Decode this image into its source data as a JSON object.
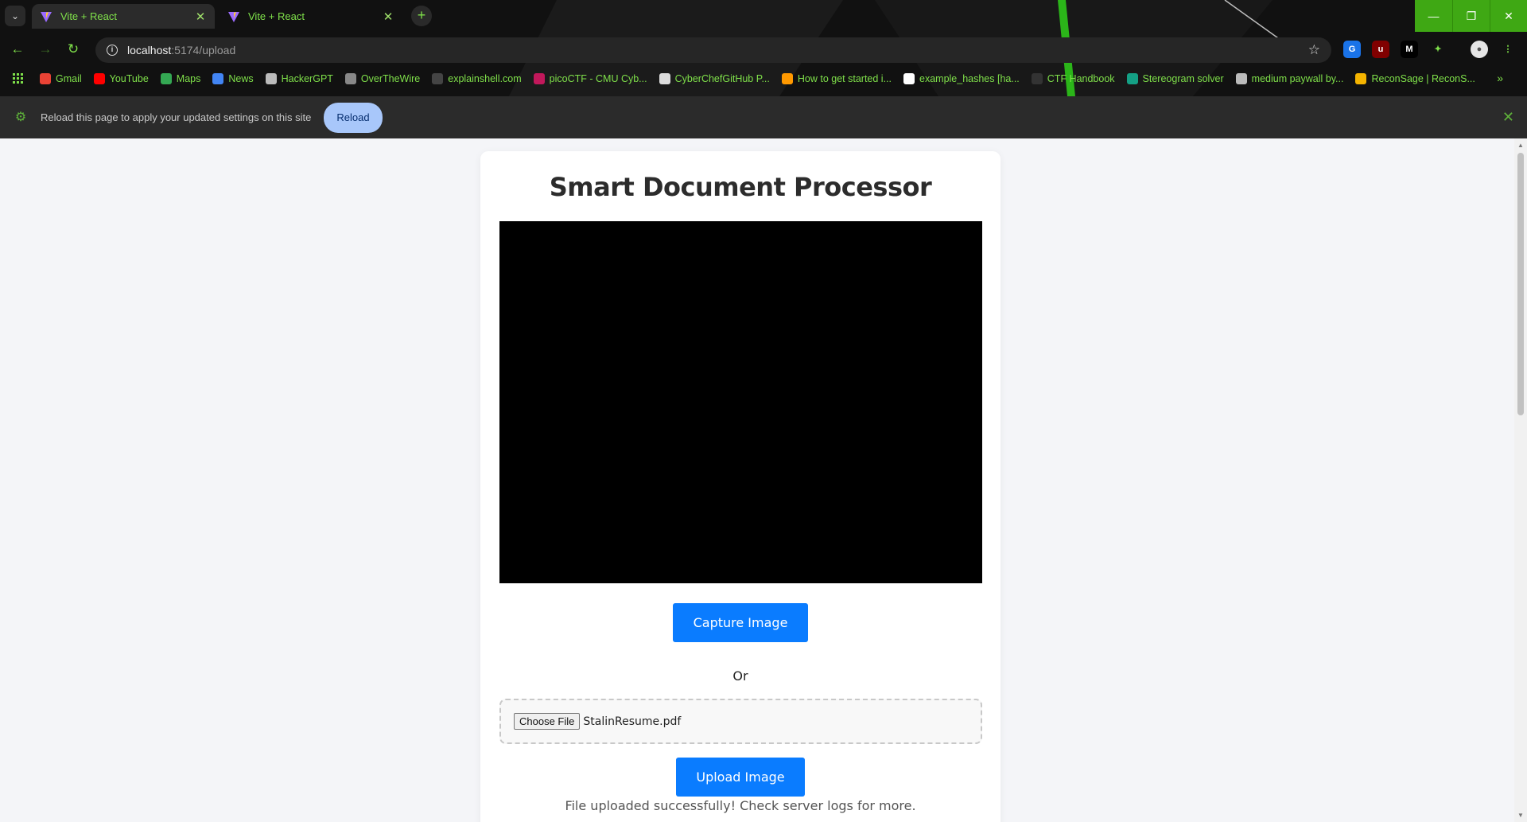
{
  "browser": {
    "tabs": [
      {
        "title": "Vite + React",
        "active": true
      },
      {
        "title": "Vite + React",
        "active": false
      }
    ],
    "url_host": "localhost",
    "url_path": ":5174/upload",
    "accent_color": "#7fe04a",
    "bookmarks": [
      {
        "label": "Gmail",
        "icon": "gmail-icon",
        "color": "#ea4335"
      },
      {
        "label": "YouTube",
        "icon": "youtube-icon",
        "color": "#ff0000"
      },
      {
        "label": "Maps",
        "icon": "maps-icon",
        "color": "#34a853"
      },
      {
        "label": "News",
        "icon": "news-icon",
        "color": "#4285f4"
      },
      {
        "label": "HackerGPT",
        "icon": "hackergpt-icon",
        "color": "#bbbbbb"
      },
      {
        "label": "OverTheWire",
        "icon": "overthewire-icon",
        "color": "#888888"
      },
      {
        "label": "explainshell.com",
        "icon": "explainshell-icon",
        "color": "#444444"
      },
      {
        "label": "picoCTF - CMU Cyb...",
        "icon": "picoctf-icon",
        "color": "#c2185b"
      },
      {
        "label": "CyberChefGitHub P...",
        "icon": "cyberchef-icon",
        "color": "#dddddd"
      },
      {
        "label": "How to get started i...",
        "icon": "reddit-icon",
        "color": "#ff9900"
      },
      {
        "label": "example_hashes [ha...",
        "icon": "hashcat-icon",
        "color": "#ffffff"
      },
      {
        "label": "CTF Handbook",
        "icon": "ctf-handbook-icon",
        "color": "#333333"
      },
      {
        "label": "Stereogram solver",
        "icon": "stereogram-icon",
        "color": "#14a085"
      },
      {
        "label": "medium paywall by...",
        "icon": "medium-icon",
        "color": "#bbbbbb"
      },
      {
        "label": "ReconSage | ReconS...",
        "icon": "lightning-icon",
        "color": "#f5b400"
      }
    ],
    "infobar": {
      "message": "Reload this page to apply your updated settings on this site",
      "reload_label": "Reload"
    }
  },
  "page": {
    "title": "Smart Document Processor",
    "capture_label": "Capture Image",
    "or_label": "Or",
    "choose_file_label": "Choose File",
    "file_name": "StalinResume.pdf",
    "upload_label": "Upload Image",
    "status": "File uploaded successfully! Check server logs for more."
  }
}
